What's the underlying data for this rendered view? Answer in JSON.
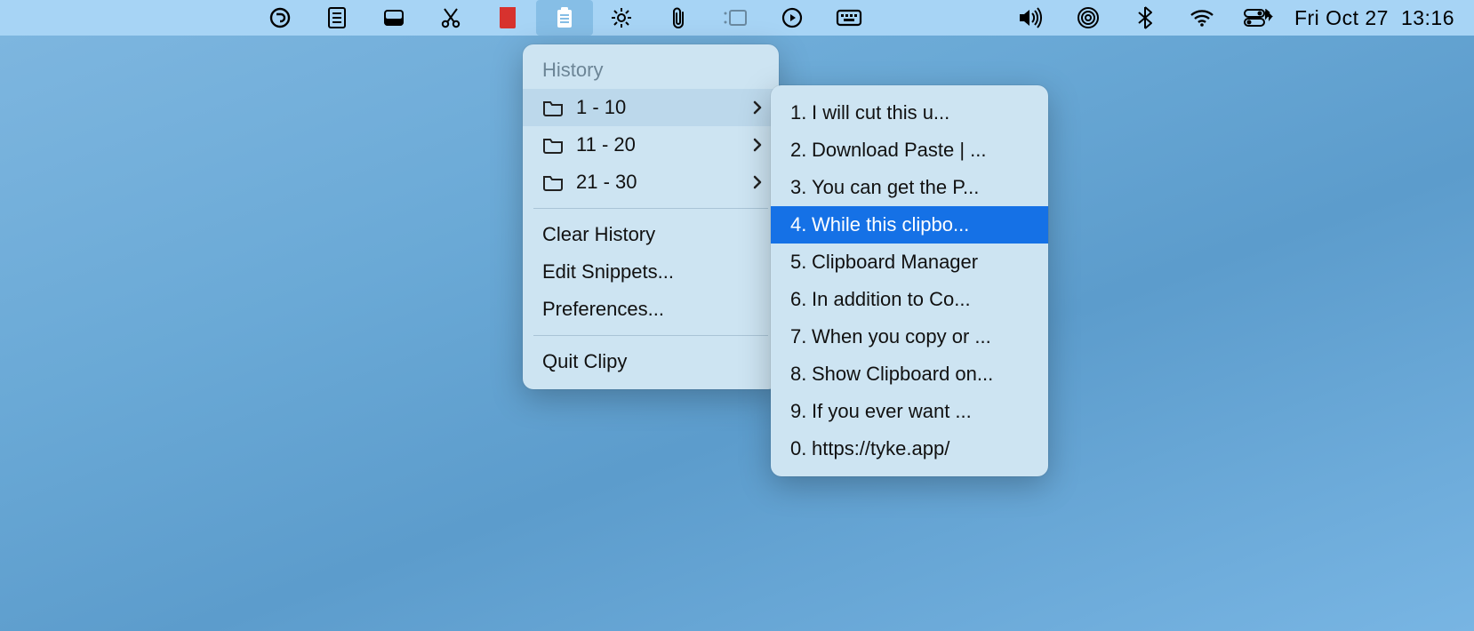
{
  "menubar": {
    "datetime_day": "Fri Oct 27",
    "datetime_time": "13:16"
  },
  "menu": {
    "header": "History",
    "groups": [
      {
        "label": "1 - 10"
      },
      {
        "label": "11 - 20"
      },
      {
        "label": "21 - 30"
      }
    ],
    "clear": "Clear History",
    "edit_snippets": "Edit Snippets...",
    "preferences": "Preferences...",
    "quit": "Quit Clipy"
  },
  "submenu": {
    "items": [
      {
        "num": "1.",
        "text": "I will cut this u..."
      },
      {
        "num": "2.",
        "text": "Download Paste | ..."
      },
      {
        "num": "3.",
        "text": "You can get the P..."
      },
      {
        "num": "4.",
        "text": "While this clipbo..."
      },
      {
        "num": "5.",
        "text": "Clipboard Manager"
      },
      {
        "num": "6.",
        "text": "In addition to Co..."
      },
      {
        "num": "7.",
        "text": "When you copy or ..."
      },
      {
        "num": "8.",
        "text": "Show Clipboard on..."
      },
      {
        "num": "9.",
        "text": "If you ever want ..."
      },
      {
        "num": "0.",
        "text": "https://tyke.app/"
      }
    ],
    "selected_index": 3
  }
}
